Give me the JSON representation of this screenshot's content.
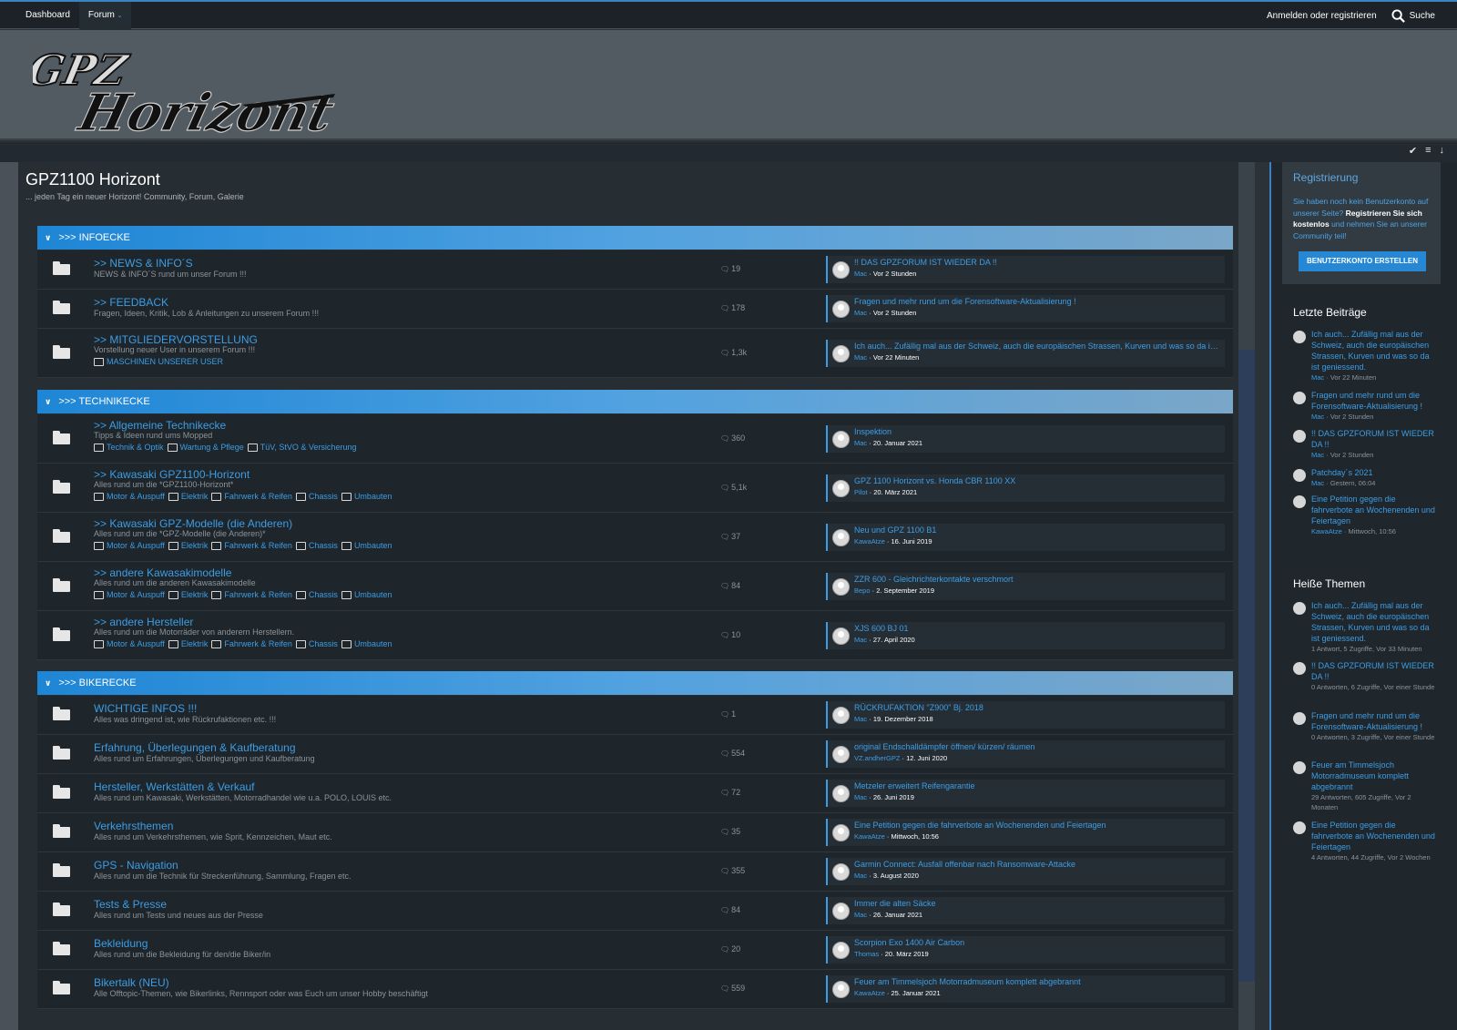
{
  "nav": {
    "dashboard": "Dashboard",
    "forum": "Forum",
    "login": "Anmelden oder registrieren",
    "search": "Suche"
  },
  "logo": {
    "text1": "GPZ",
    "text2": "Horizont"
  },
  "page": {
    "title": "GPZ1100 Horizont",
    "description": "... jeden Tag ein neuer Horizont! Community, Forum, Galerie"
  },
  "categories": [
    {
      "label": ">>> INFOECKE"
    },
    {
      "label": ">>> TECHNIKECKE"
    },
    {
      "label": ">>> BIKERECKE"
    }
  ],
  "boards": [
    {
      "title": ">> NEWS & INFO´S",
      "desc": "NEWS & INFO´S rund um unser Forum !!!",
      "count": "19",
      "last_title": "!! DAS GPZFORUM IST WIEDER DA !!",
      "last_user": "Mac",
      "last_time": "Vor 2 Stunden",
      "subs": []
    },
    {
      "title": ">> FEEDBACK",
      "desc": "Fragen, Ideen, Kritik, Lob & Anleitungen zu unserem Forum !!!",
      "count": "178",
      "last_title": "Fragen und mehr rund um die Forensoftware-Aktualisierung !",
      "last_user": "Mac",
      "last_time": "Vor 2 Stunden",
      "subs": []
    },
    {
      "title": ">> MITGLIEDERVORSTELLUNG",
      "desc": "Vorstellung neuer User in unserem Forum !!!",
      "count": "1,3k",
      "last_title": "Ich auch... Zufällig mal aus der Schweiz, auch die europäischen Strassen, Kurven und was so da ist …",
      "last_user": "Mac",
      "last_time": "Vor 22 Minuten",
      "subs": [
        "MASCHINEN UNSERER USER"
      ]
    },
    {
      "title": ">> Allgemeine Technikecke",
      "desc": "Tipps & Ideen rund ums Mopped",
      "count": "360",
      "last_title": "Inspektion",
      "last_user": "Mac",
      "last_time": "20. Januar 2021",
      "subs": [
        "Technik & Optik",
        "Wartung & Pflege",
        "TüV, StVO & Versicherung"
      ]
    },
    {
      "title": ">> Kawasaki GPZ1100-Horizont",
      "desc": "Alles rund um die *GPZ1100-Horizont*",
      "count": "5,1k",
      "last_title": "GPZ 1100 Horizont vs. Honda CBR 1100 XX",
      "last_user": "Pilot",
      "last_time": "20. März 2021",
      "subs": [
        "Motor & Auspuff",
        "Elektrik",
        "Fahrwerk & Reifen",
        "Chassis",
        "Umbauten"
      ]
    },
    {
      "title": ">> Kawasaki GPZ-Modelle (die Anderen)",
      "desc": "Alles rund um die *GPZ-Modelle (die Anderen)*",
      "count": "37",
      "last_title": "Neu und GPZ 1100 B1",
      "last_user": "KawaAtze",
      "last_time": "16. Juni 2019",
      "subs": [
        "Motor & Auspuff",
        "Elektrik",
        "Fahrwerk & Reifen",
        "Chassis",
        "Umbauten"
      ]
    },
    {
      "title": ">> andere Kawasakimodelle",
      "desc": "Alles rund um die anderen Kawasakimodelle",
      "count": "84",
      "last_title": "ZZR 600 - Gleichrichterkontakte verschmort",
      "last_user": "Bepo",
      "last_time": "2. September 2019",
      "subs": [
        "Motor & Auspuff",
        "Elektrik",
        "Fahrwerk & Reifen",
        "Chassis",
        "Umbauten"
      ]
    },
    {
      "title": ">> andere Hersteller",
      "desc": "Alles rund um die Motorräder von anderern Herstellern.",
      "count": "10",
      "last_title": "XJS 600 BJ 01",
      "last_user": "Mac",
      "last_time": "27. April 2020",
      "subs": [
        "Motor & Auspuff",
        "Elektrik",
        "Fahrwerk & Reifen",
        "Chassis",
        "Umbauten"
      ]
    },
    {
      "title": "WICHTIGE INFOS !!!",
      "desc": "Alles was dringend ist, wie Rückrufaktionen etc. !!!",
      "count": "1",
      "last_title": "RÜCKRUFAKTION \"Z900\" Bj. 2018",
      "last_user": "Mac",
      "last_time": "19. Dezember 2018",
      "subs": []
    },
    {
      "title": "Erfahrung, Überlegungen & Kaufberatung",
      "desc": "Alles rund um Erfahrungen, Überlegungen und Kaufberatung",
      "count": "554",
      "last_title": "original Endschalldämpfer öffnen/ kürzen/ räumen",
      "last_user": "VZ.andherGPZ",
      "last_time": "12. Juni 2020",
      "subs": []
    },
    {
      "title": "Hersteller, Werkstätten & Verkauf",
      "desc": "Alles rund um Kawasaki, Werkstätten, Motorradhandel wie u.a. POLO, LOUIS etc.",
      "count": "72",
      "last_title": "Metzeler erweitert Reifengarantie",
      "last_user": "Mac",
      "last_time": "26. Juni 2019",
      "subs": []
    },
    {
      "title": "Verkehrsthemen",
      "desc": "Alles rund um Verkehrsthemen, wie Sprit, Kennzeichen, Maut etc.",
      "count": "35",
      "last_title": "Eine Petition gegen die fahrverbote an Wochenenden und Feiertagen",
      "last_user": "KawaAtze",
      "last_time": "Mittwoch, 10:56",
      "subs": []
    },
    {
      "title": "GPS - Navigation",
      "desc": "Alles rund um die Technik für Streckenführung, Sammlung, Fragen etc.",
      "count": "355",
      "last_title": "Garmin Connect: Ausfall offenbar nach Ransomware-Attacke",
      "last_user": "Mac",
      "last_time": "3. August 2020",
      "subs": []
    },
    {
      "title": "Tests & Presse",
      "desc": "Alles rund um Tests und neues aus der Presse",
      "count": "84",
      "last_title": "Immer die alten Säcke",
      "last_user": "Mac",
      "last_time": "26. Januar 2021",
      "subs": []
    },
    {
      "title": "Bekleidung",
      "desc": "Alles rund um die Bekleidung für den/die Biker/in",
      "count": "20",
      "last_title": "Scorpion Exo 1400 Air Carbon",
      "last_user": "Thomas",
      "last_time": "20. März 2019",
      "subs": []
    },
    {
      "title": "Bikertalk (NEU)",
      "desc": "Alle Offtopic-Themen, wie Bikerlinks, Rennsport oder was Euch um unser Hobby beschäftigt",
      "count": "559",
      "last_title": "Feuer am Timmelsjoch Motorradmuseum komplett abgebrannt",
      "last_user": "KawaAtze",
      "last_time": "25. Januar 2021",
      "subs": []
    }
  ],
  "sidebar": {
    "registration": {
      "heading": "Registrierung",
      "text1": "Sie haben noch kein Benutzerkonto auf unserer Seite?",
      "bold": "Registrieren Sie sich kostenlos",
      "text2": "und nehmen Sie an unserer Community teil!",
      "button": "BENUTZERKONTO ERSTELLEN"
    },
    "latest_heading": "Letzte Beiträge",
    "latest": [
      {
        "title": "Ich auch... Zufällig mal aus der Schweiz, auch die europäischen Strassen, Kurven und was so da ist geniessend.",
        "user": "Mac",
        "meta": " · Vor 22 Minuten"
      },
      {
        "title": "Fragen und mehr rund um die Forensoftware-Aktualisierung !",
        "user": "Mac",
        "meta": " · Vor 2 Stunden"
      },
      {
        "title": "!! DAS GPZFORUM IST WIEDER DA !!",
        "user": "Mac",
        "meta": " · Vor 2 Stunden"
      },
      {
        "title": "Patchday´s 2021",
        "user": "Mac",
        "meta": " · Gestern, 06:04"
      },
      {
        "title": "Eine Petition gegen die fahrverbote an Wochenenden und Feiertagen",
        "user": "KawaAtze",
        "meta": " · Mittwoch, 10:56"
      }
    ],
    "hot_heading": "Heiße Themen",
    "hot": [
      {
        "title": "Ich auch... Zufällig mal aus der Schweiz, auch die europäischen Strassen, Kurven und was so da ist geniessend.",
        "meta": "1 Antwort, 5 Zugriffe, Vor 33 Minuten"
      },
      {
        "title": "!! DAS GPZFORUM IST WIEDER DA !!",
        "meta": "0 Antworten, 6 Zugriffe, Vor einer Stunde"
      },
      {
        "title": "Fragen und mehr rund um die Forensoftware-Aktualisierung !",
        "meta": "0 Antworten, 3 Zugriffe, Vor einer Stunde"
      },
      {
        "title": "Feuer am Timmelsjoch Motorradmuseum komplett abgebrannt",
        "meta": "29 Antworten, 605 Zugriffe, Vor 2 Monaten"
      },
      {
        "title": "Eine Petition gegen die fahrverbote an Wochenenden und Feiertagen",
        "meta": "4 Antworten, 44 Zugriffe, Vor 2 Wochen"
      }
    ]
  }
}
